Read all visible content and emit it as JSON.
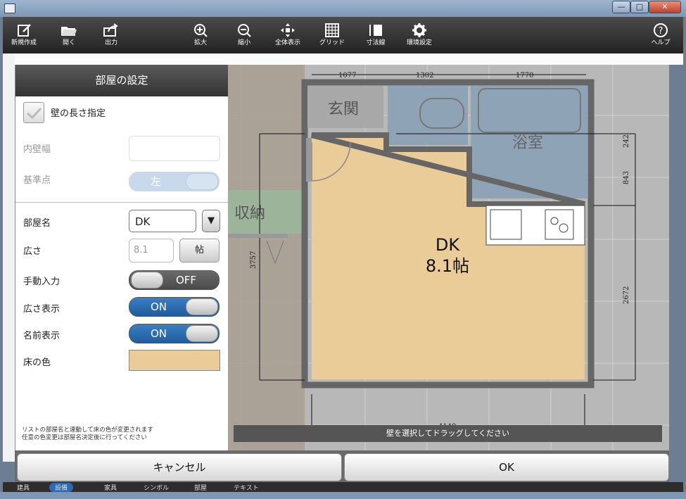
{
  "toolbar": {
    "buttons": [
      {
        "id": "new",
        "label": "新規作成",
        "icon": "new-document-icon"
      },
      {
        "id": "open",
        "label": "開く",
        "icon": "folder-open-icon"
      },
      {
        "id": "export",
        "label": "出力",
        "icon": "share-export-icon"
      },
      {
        "id": "zoom_in",
        "label": "拡大",
        "icon": "zoom-in-icon"
      },
      {
        "id": "zoom_out",
        "label": "縮小",
        "icon": "zoom-out-icon"
      },
      {
        "id": "fit",
        "label": "全体表示",
        "icon": "fit-all-icon"
      },
      {
        "id": "grid",
        "label": "グリッド",
        "icon": "grid-icon"
      },
      {
        "id": "dimension",
        "label": "寸法線",
        "icon": "dimension-line-icon"
      },
      {
        "id": "settings",
        "label": "環境設定",
        "icon": "gear-icon"
      },
      {
        "id": "help",
        "label": "ヘルプ",
        "icon": "help-icon"
      }
    ]
  },
  "panel": {
    "title": "部屋の設定",
    "wall_length_label": "壁の長さ指定",
    "wall_length_checked": false,
    "inner_wall_label": "内壁幅",
    "inner_wall_value": "",
    "base_point_label": "基準点",
    "base_point_value": "左",
    "room_name_label": "部屋名",
    "room_name_value": "DK",
    "dropdown_arrow": "▼",
    "area_label": "広さ",
    "area_value": "8.1",
    "area_unit": "帖",
    "manual_input_label": "手動入力",
    "manual_input_value": "OFF",
    "show_area_label": "広さ表示",
    "show_area_value": "ON",
    "show_name_label": "名前表示",
    "show_name_value": "ON",
    "floor_color_label": "床の色",
    "floor_color": "#e9cc97",
    "note_line1": "リストの部屋名と連動して床の色が変更されます",
    "note_line2": "任意の色変更は部屋名決定後に行ってください"
  },
  "plan": {
    "room_name": "DK",
    "room_area": "8.1帖",
    "entrance_label": "玄関",
    "bath_label": "浴室",
    "storage_label": "収納",
    "dims": {
      "top1": "1077",
      "top2": "1302",
      "top3": "1770",
      "right1": "242",
      "right2": "843",
      "right3": "2672",
      "left1": "3757",
      "bottom1": "4149"
    },
    "hint": "壁を選択してドラッグしてください"
  },
  "actions": {
    "cancel": "キャンセル",
    "ok": "OK"
  },
  "bottom_tabs": [
    "建具",
    "設備",
    "家具",
    "シンボル",
    "部屋",
    "テキスト"
  ],
  "active_tab": "設備",
  "colors": {
    "floor": "#e9cc97",
    "toggle_on": "#2f6fb2",
    "wall": "#6a6a6a"
  }
}
